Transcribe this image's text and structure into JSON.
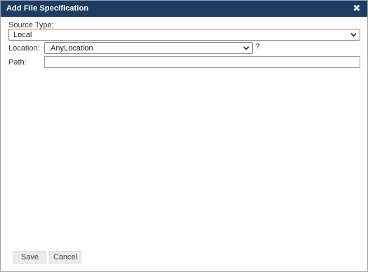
{
  "dialog": {
    "title": "Add File Specification",
    "close_icon": "close-icon"
  },
  "source_type": {
    "label": "Source Type:",
    "value": "Local"
  },
  "location": {
    "label": "Location:",
    "value": "AnyLocation",
    "help": "?"
  },
  "path": {
    "label": "Path:",
    "value": ""
  },
  "buttons": {
    "save": "Save",
    "cancel": "Cancel"
  },
  "colors": {
    "titlebar": "#1f3d63",
    "help_link": "#2a6ebb"
  }
}
